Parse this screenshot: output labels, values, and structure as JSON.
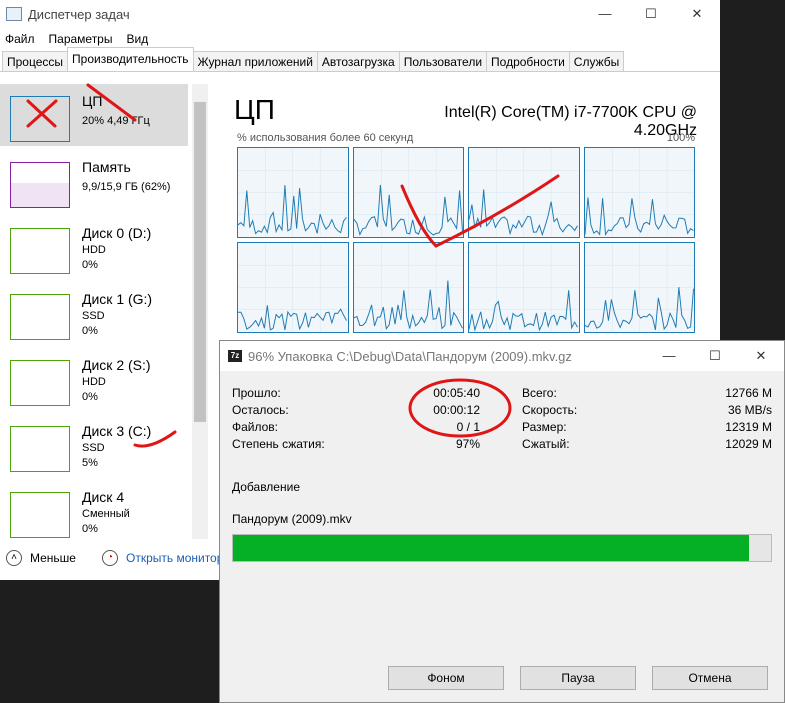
{
  "taskmgr": {
    "title": "Диспетчер задач",
    "menu": [
      "Файл",
      "Параметры",
      "Вид"
    ],
    "tabs": [
      "Процессы",
      "Производительность",
      "Журнал приложений",
      "Автозагрузка",
      "Пользователи",
      "Подробности",
      "Службы"
    ],
    "sidebar": [
      {
        "name": "ЦП",
        "l1": "20% 4,49 ГГц",
        "l2": "",
        "color": "#1d7bb5"
      },
      {
        "name": "Память",
        "l1": "9,9/15,9 ГБ (62%)",
        "l2": "",
        "color": "#8b1fa8"
      },
      {
        "name": "Диск 0 (D:)",
        "l1": "HDD",
        "l2": "0%",
        "color": "#4da30a"
      },
      {
        "name": "Диск 1 (G:)",
        "l1": "SSD",
        "l2": "0%",
        "color": "#4da30a"
      },
      {
        "name": "Диск 2 (S:)",
        "l1": "HDD",
        "l2": "0%",
        "color": "#4da30a"
      },
      {
        "name": "Диск 3 (C:)",
        "l1": "SSD",
        "l2": "5%",
        "color": "#4da30a"
      },
      {
        "name": "Диск 4",
        "l1": "Сменный",
        "l2": "0%",
        "color": "#4da30a"
      }
    ],
    "less": "Меньше",
    "open_monitor": "Открыть монитор ресурсов",
    "main": {
      "title": "ЦП",
      "cpu": "Intel(R) Core(TM) i7-7700K CPU @ 4.20GHz",
      "usage_label": "% использования более 60 секунд",
      "max": "100%"
    }
  },
  "sevenzip": {
    "title": "96% Упаковка C:\\Debug\\Data\\Пандорум (2009).mkv.gz",
    "progress": 0.96,
    "left": [
      [
        "Прошло:",
        "00:05:40"
      ],
      [
        "Осталось:",
        "00:00:12"
      ],
      [
        "Файлов:",
        "0 / 1"
      ],
      [
        "Степень сжатия:",
        "97%"
      ]
    ],
    "right": [
      [
        "Всего:",
        "12766 M"
      ],
      [
        "Скорость:",
        "36 MB/s"
      ],
      [
        "Размер:",
        "12319 M"
      ],
      [
        "Сжатый:",
        "12029 M"
      ]
    ],
    "action": "Добавление",
    "file": "Пандорум (2009).mkv",
    "buttons": [
      "Фоном",
      "Пауза",
      "Отмена"
    ]
  }
}
